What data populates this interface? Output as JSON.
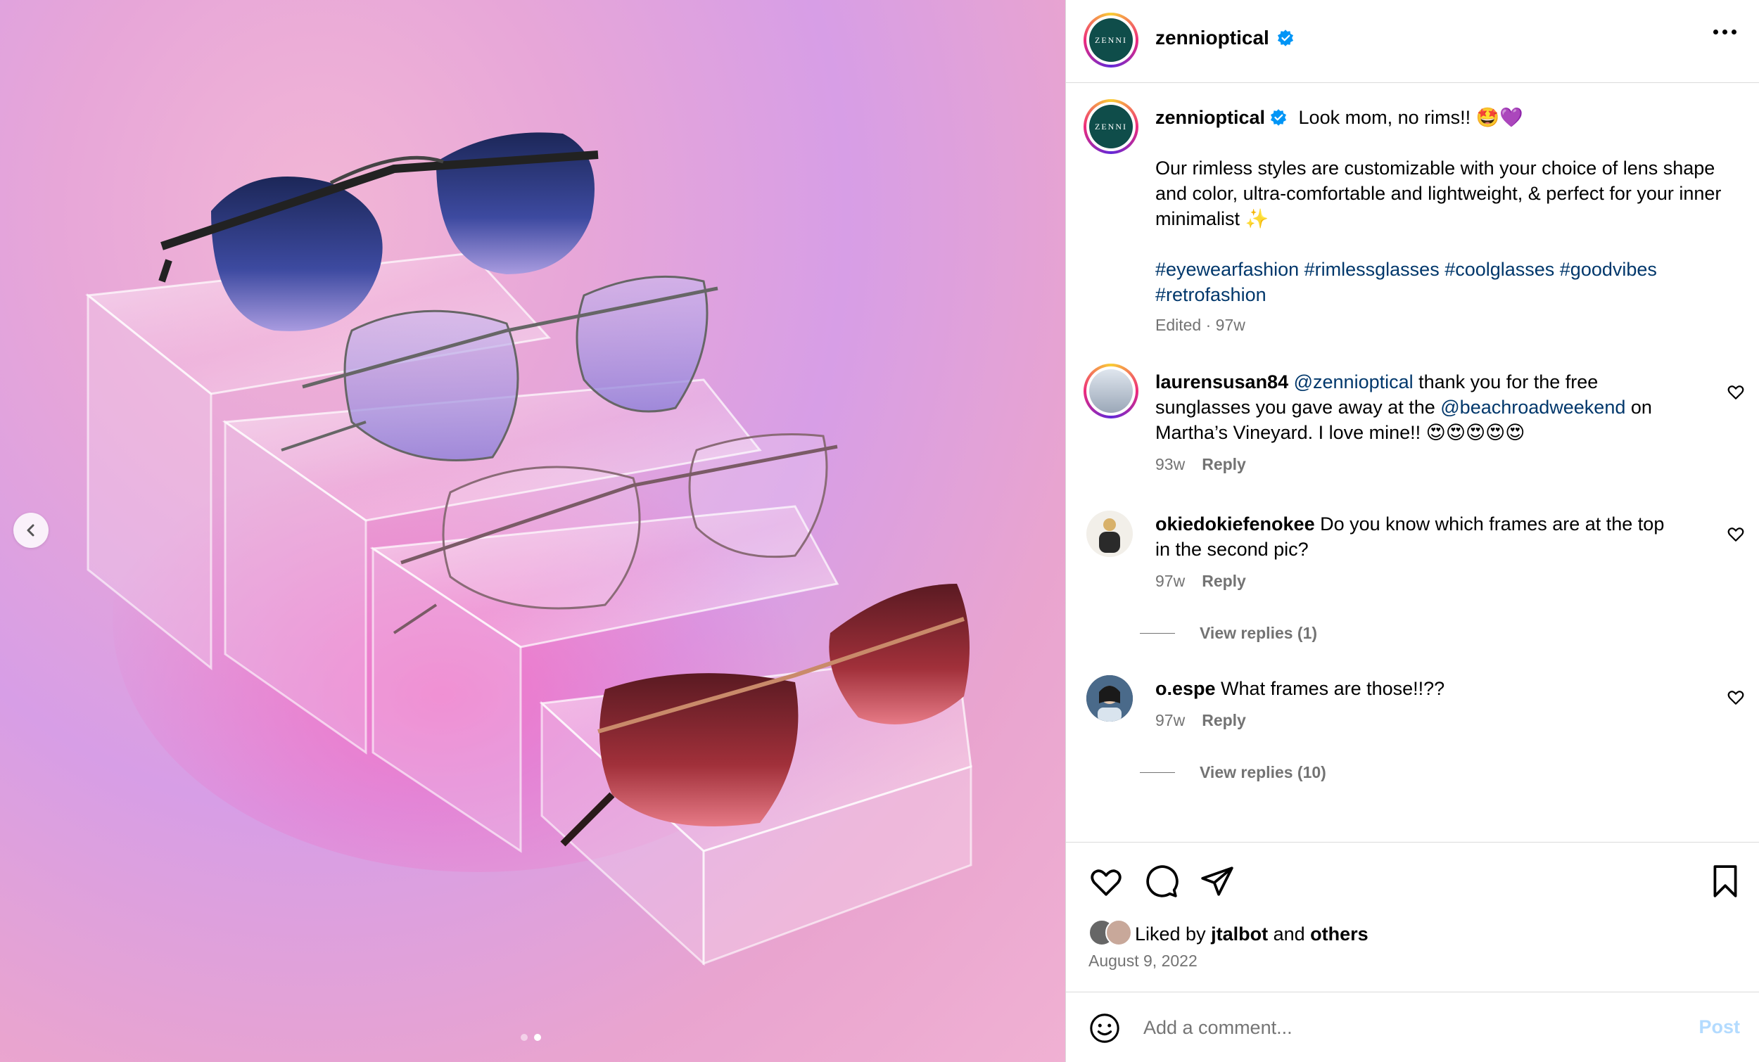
{
  "post": {
    "author": "zennioptical",
    "logo_text": "ZENNI",
    "caption_lead": "Look mom, no rims!! 🤩💜",
    "caption_body": "Our rimless styles are customizable with your choice of lens shape and color, ultra-comfortable and lightweight, & perfect for your inner minimalist ✨",
    "hashtags_line1": "#eyewearfashion #rimlessglasses #coolglasses #goodvibes",
    "hashtags_line2": "#retrofashion",
    "caption_meta": "Edited · 97w",
    "carousel": {
      "total": 2,
      "active": 2
    }
  },
  "comments": [
    {
      "user": "laurensusan84",
      "mention1": "@zennioptical",
      "text1": " thank you for the free",
      "text2a": "sunglasses you gave away at the ",
      "mention2": "@beachroadweekend",
      "text2b": " on",
      "text3": "Martha’s Vineyard. I love mine!! 😍😍😍😍😍",
      "age": "93w",
      "reply": "Reply"
    },
    {
      "user": "okiedokiefenokee",
      "text1": " Do you know which frames are at the top",
      "text2": "in the second pic?",
      "age": "97w",
      "reply": "Reply",
      "view_replies": "View replies (1)"
    },
    {
      "user": "o.espe",
      "text1": " What frames are those!!??",
      "age": "97w",
      "reply": "Reply",
      "view_replies": "View replies (10)"
    }
  ],
  "likes": {
    "prefix": "Liked by ",
    "user": "jtalbot",
    "middle": " and ",
    "others": "others"
  },
  "date": "August 9, 2022",
  "composer": {
    "placeholder": "Add a comment...",
    "post_label": "Post"
  },
  "colors": {
    "link": "#00376b",
    "verified": "#0095f6",
    "post_disabled": "#b3dbff",
    "logo_bg": "#0f4d4a"
  }
}
